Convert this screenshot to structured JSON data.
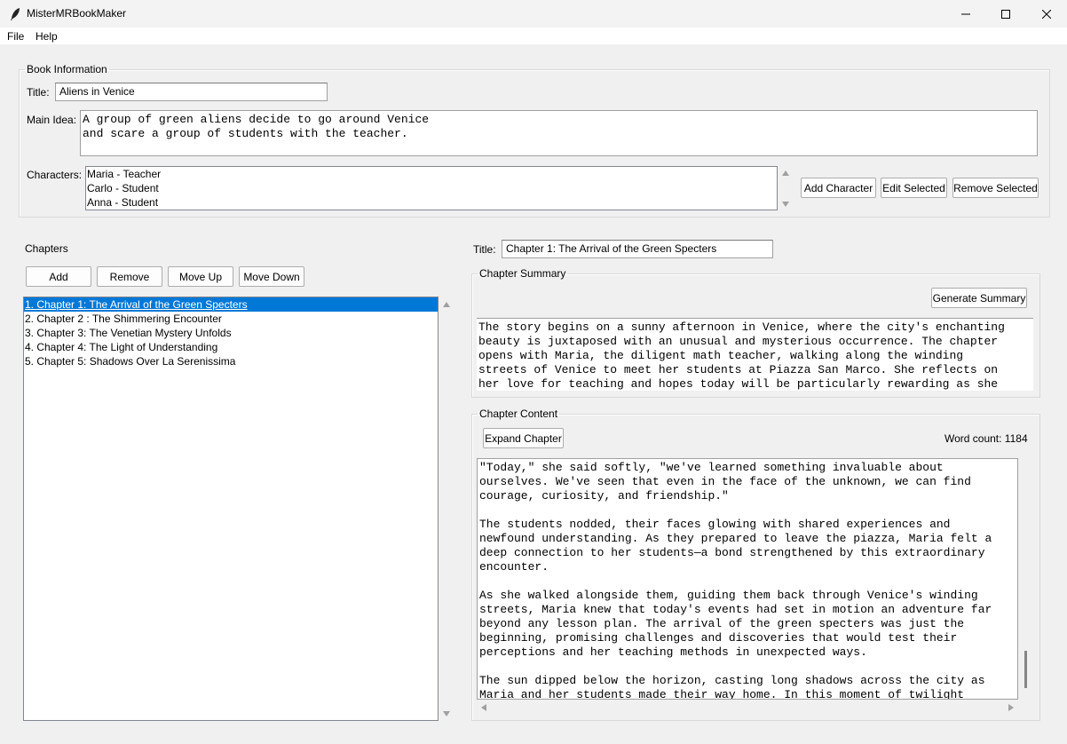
{
  "window": {
    "title": "MisterMRBookMaker",
    "icon": "quill-icon",
    "minimize_icon": "minimize-icon",
    "maximize_icon": "maximize-icon",
    "close_icon": "close-icon"
  },
  "menu": {
    "file": "File",
    "help": "Help"
  },
  "book": {
    "section_label": "Book Information",
    "title_label": "Title:",
    "title_value": "Aliens in Venice",
    "main_idea_label": "Main Idea:",
    "main_idea_value": "A group of green aliens decide to go around Venice\nand scare a group of students with the teacher.",
    "characters_label": "Characters:",
    "characters": [
      "Maria - Teacher",
      "Carlo - Student",
      "Anna - Student"
    ],
    "add_character": "Add Character",
    "edit_selected": "Edit Selected",
    "remove_selected": "Remove Selected"
  },
  "chapters": {
    "section_label": "Chapters",
    "add": "Add",
    "remove": "Remove",
    "move_up": "Move Up",
    "move_down": "Move Down",
    "items": [
      "1. Chapter 1: The Arrival of the Green Specters",
      "2. Chapter 2 : The Shimmering Encounter",
      "3. Chapter 3: The Venetian Mystery Unfolds",
      "4. Chapter 4: The Light of Understanding",
      "5. Chapter 5: Shadows Over La Serenissima"
    ],
    "selected_index": 0
  },
  "chapter_editor": {
    "title_label": "Title:",
    "title_value": "Chapter 1: The Arrival of the Green Specters",
    "summary_label": "Chapter Summary",
    "generate_summary": "Generate Summary",
    "summary_text": "The story begins on a sunny afternoon in Venice, where the city's enchanting\nbeauty is juxtaposed with an unusual and mysterious occurrence. The chapter\nopens with Maria, the diligent math teacher, walking along the winding\nstreets of Venice to meet her students at Piazza San Marco. She reflects on\nher love for teaching and hopes today will be particularly rewarding as she",
    "content_label": "Chapter Content",
    "expand_chapter": "Expand Chapter",
    "word_count": "Word count: 1184",
    "content_text": "\"Today,\" she said softly, \"we've learned something invaluable about\nourselves. We've seen that even in the face of the unknown, we can find\ncourage, curiosity, and friendship.\"\n\nThe students nodded, their faces glowing with shared experiences and\nnewfound understanding. As they prepared to leave the piazza, Maria felt a\ndeep connection to her students—a bond strengthened by this extraordinary\nencounter.\n\nAs she walked alongside them, guiding them back through Venice's winding\nstreets, Maria knew that today's events had set in motion an adventure far\nbeyond any lesson plan. The arrival of the green specters was just the\nbeginning, promising challenges and discoveries that would test their\nperceptions and her teaching methods in unexpected ways.\n\nThe sun dipped below the horizon, casting long shadows across the city as\nMaria and her students made their way home. In this moment of twilight"
  },
  "colors": {
    "selection": "#0078d7",
    "background": "#f0f0f0"
  }
}
